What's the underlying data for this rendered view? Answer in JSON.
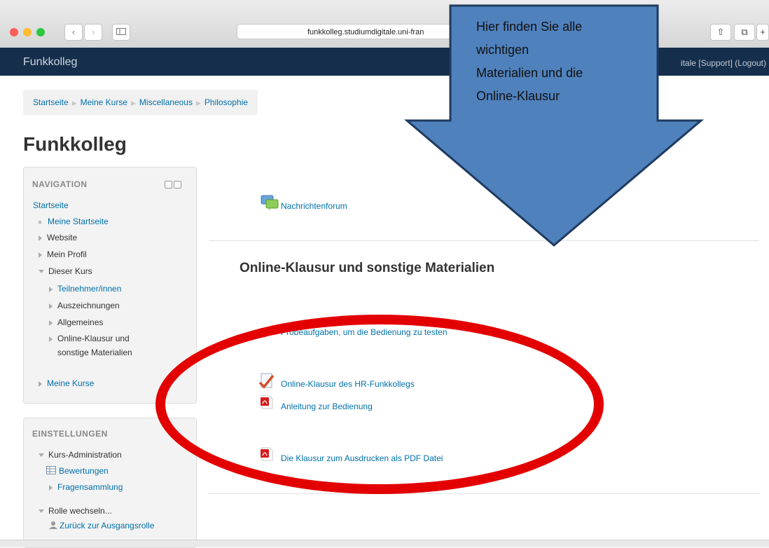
{
  "browser": {
    "url": "funkkolleg.studiumdigitale.uni-fran",
    "back_glyph": "‹",
    "forward_glyph": "›",
    "share_glyph": "⇧",
    "tabs_glyph": "⧉",
    "newtab_glyph": "+"
  },
  "header": {
    "site_name": "Funkkolleg",
    "user_menu": "itale [Support] (Logout)"
  },
  "breadcrumb": [
    "Startseite",
    "Meine Kurse",
    "Miscellaneous",
    "Philosophie"
  ],
  "page_title": "Funkkolleg",
  "navigation": {
    "heading": "NAVIGATION",
    "home": "Startseite",
    "my_home": "Meine Startseite",
    "website": "Website",
    "profile": "Mein Profil",
    "this_course": "Dieser Kurs",
    "participants": "Teilnehmer/innen",
    "badges": "Auszeichnungen",
    "general": "Allgemeines",
    "section_line1": "Online-Klausur und",
    "section_line2": "sonstige Materialien",
    "my_courses": "Meine Kurse"
  },
  "settings": {
    "heading": "EINSTELLUNGEN",
    "course_admin": "Kurs-Administration",
    "grades": "Bewertungen",
    "question_bank": "Fragensammlung",
    "switch_role": "Rolle wechseln...",
    "back_role": "Zurück zur Ausgangsrolle"
  },
  "main": {
    "forum": "Nachrichtenforum",
    "section_title": "Online-Klausur und sonstige Materialien",
    "activities": {
      "practice": "Probeaufgaben, um die Bedienung zu testen",
      "exam": "Online-Klausur des HR-Funkkollegs",
      "manual": "Anleitung zur Bedienung",
      "pdf": "Die Klausur zum Ausdrucken als PDF Datei"
    }
  },
  "callout": {
    "line1": "Hier finden Sie alle",
    "line2": "wichtigen",
    "line3": "Materialien und die",
    "line4": "Online-Klausur"
  },
  "colors": {
    "header_bg": "#142e4b",
    "link": "#0070a8",
    "callout_fill": "#4f81bd",
    "callout_border": "#1f3a5f",
    "ellipse": "#e30000"
  }
}
